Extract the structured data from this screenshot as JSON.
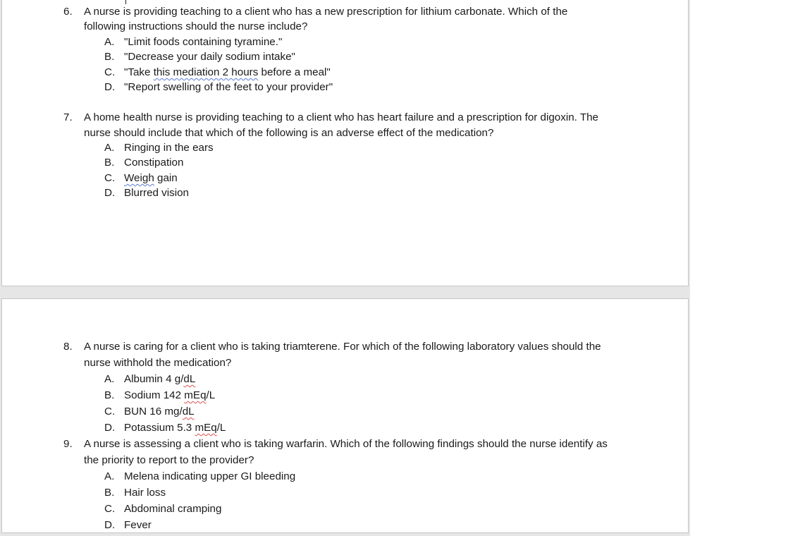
{
  "document": {
    "questions": [
      {
        "number": "6.",
        "lines": [
          "A nurse is providing teaching to a client who has a new prescription for lithium carbonate. Which of the",
          "following instructions should the nurse include?"
        ],
        "options": [
          {
            "letter": "A.",
            "pre": "\"Limit foods containing tyramine.\"",
            "flag": "",
            "post": ""
          },
          {
            "letter": "B.",
            "pre": "\"Decrease your daily sodium intake\"",
            "flag": "",
            "post": ""
          },
          {
            "letter": "C.",
            "pre": "\"Take ",
            "flag": "this mediation 2 hours",
            "post": " before a meal\""
          },
          {
            "letter": "D.",
            "pre": "\"Report swelling of the feet to your provider\"",
            "flag": "",
            "post": ""
          }
        ]
      },
      {
        "number": "7.",
        "lines": [
          "A home health nurse is providing teaching to a client who has heart failure and a prescription for digoxin. The",
          "nurse should include that which of the following is an adverse effect of the medication?"
        ],
        "options": [
          {
            "letter": "A.",
            "pre": "Ringing in the ears",
            "flag": "",
            "post": ""
          },
          {
            "letter": "B.",
            "pre": "Constipation",
            "flag": "",
            "post": ""
          },
          {
            "letter": "C.",
            "pre": "",
            "flag": "Weigh",
            "post": " gain"
          },
          {
            "letter": "D.",
            "pre": "Blurred vision",
            "flag": "",
            "post": ""
          }
        ]
      },
      {
        "number": "8.",
        "lines": [
          "A nurse is caring for a client who is taking triamterene. For which of the following laboratory values should the",
          "nurse withhold the medication?"
        ],
        "options": [
          {
            "letter": "A.",
            "pre": "Albumin 4 g/",
            "flag": "dL",
            "post": ""
          },
          {
            "letter": "B.",
            "pre": "Sodium 142 ",
            "flag": "mEq",
            "post": "/L"
          },
          {
            "letter": "C.",
            "pre": "BUN 16 mg/",
            "flag": "dL",
            "post": ""
          },
          {
            "letter": "D.",
            "pre": "Potassium 5.3 ",
            "flag": "mEq",
            "post": "/L"
          }
        ]
      },
      {
        "number": "9.",
        "lines": [
          "A nurse is assessing a client who is taking warfarin. Which of the following findings should the nurse identify as",
          "the priority to report to the provider?"
        ],
        "options": [
          {
            "letter": "A.",
            "pre": "Melena indicating upper GI bleeding",
            "flag": "",
            "post": ""
          },
          {
            "letter": "B.",
            "pre": "Hair loss",
            "flag": "",
            "post": ""
          },
          {
            "letter": "C.",
            "pre": "Abdominal cramping",
            "flag": "",
            "post": ""
          },
          {
            "letter": "D.",
            "pre": "Fever",
            "flag": "",
            "post": ""
          }
        ]
      }
    ]
  }
}
